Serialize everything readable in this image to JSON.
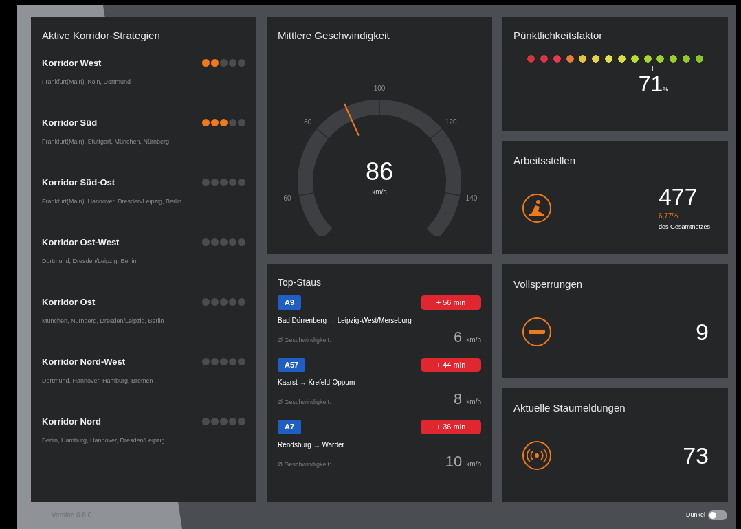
{
  "corridors": {
    "title": "Aktive Korridor-Strategien",
    "items": [
      {
        "name": "Korridor West",
        "route": "Frankfurt(Main), Köln, Dortmund",
        "stars": 2
      },
      {
        "name": "Korridor Süd",
        "route": "Frankfurt(Main), Stuttgart, München, Nürnberg",
        "stars": 3
      },
      {
        "name": "Korridor Süd-Ost",
        "route": "Frankfurt(Main), Hannover, Dresden/Leipzig, Berlin",
        "stars": 0
      },
      {
        "name": "Korridor Ost-West",
        "route": "Dortmund, Dresden/Leipzig, Berlin",
        "stars": 0
      },
      {
        "name": "Korridor Ost",
        "route": "München, Nürnberg, Dresden/Leipzig, Berlin",
        "stars": 0
      },
      {
        "name": "Korridor Nord-West",
        "route": "Dortmund, Hannover, Hamburg, Bremen",
        "stars": 0
      },
      {
        "name": "Korridor Nord",
        "route": "Berlin, Hamburg, Hannover, Dresden/Leipzig",
        "stars": 0
      }
    ]
  },
  "speed": {
    "title": "Mittlere Geschwindigkeit",
    "ticks": [
      "60",
      "80",
      "100",
      "120",
      "140"
    ],
    "value": "86",
    "unit": "km/h",
    "level": 0.41
  },
  "jams": {
    "title": "Top-Staus",
    "items": [
      {
        "road": "A9",
        "delay": "+ 56 min",
        "route": "Bad Dürrenberg → Leipzig-West/Merseburg",
        "speed_label": "Ø Geschwindigkeit:",
        "speed": "6",
        "unit": "km/h"
      },
      {
        "road": "A57",
        "delay": "+ 44 min",
        "route": "Kaarst → Krefeld-Oppum",
        "speed_label": "Ø Geschwindigkeit:",
        "speed": "8",
        "unit": "km/h"
      },
      {
        "road": "A7",
        "delay": "+ 36 min",
        "route": "Rendsburg → Warder",
        "speed_label": "Ø Geschwindigkeit:",
        "speed": "10",
        "unit": "km/h"
      }
    ]
  },
  "punctuality": {
    "title": "Pünktlichkeitsfaktor",
    "level": 0.71,
    "value": "71",
    "unit": "%"
  },
  "stats": [
    {
      "kind": "roadwork",
      "title": "Arbeitsstellen",
      "value": "477",
      "share": "6,77%",
      "share_label": "des Gesamtnetzes"
    },
    {
      "kind": "closure",
      "title": "Vollsperrungen",
      "value": "9"
    },
    {
      "kind": "broadcast",
      "title": "Aktuelle Staumeldungen",
      "value": "73"
    }
  ],
  "footer": {
    "version": "Version 0.8.0",
    "toggle": {
      "label": "Dunkel",
      "on": false
    }
  }
}
